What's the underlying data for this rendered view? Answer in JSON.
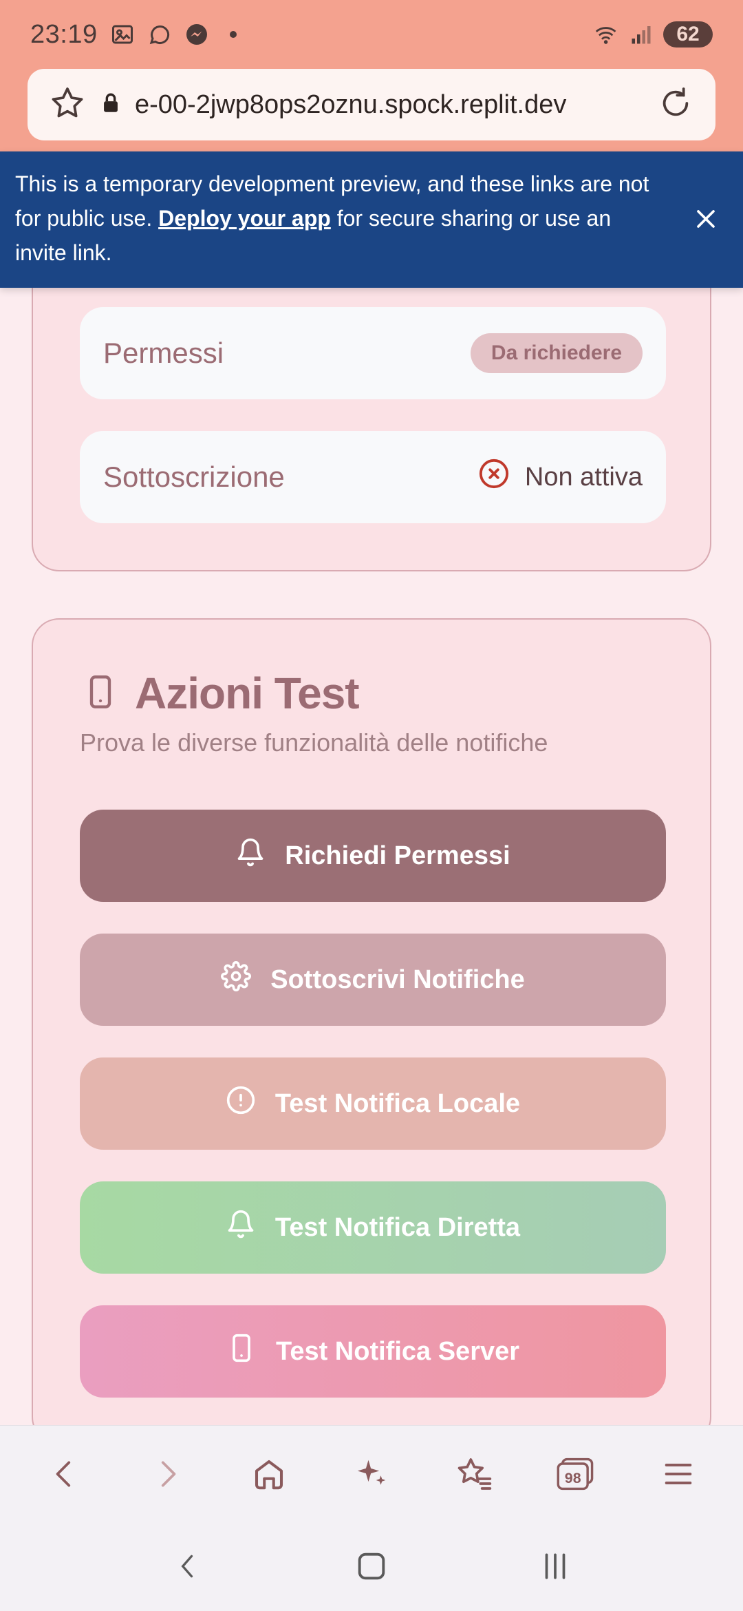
{
  "status_bar": {
    "time": "23:19",
    "battery": "62",
    "icons": [
      "gallery-icon",
      "whatsapp-icon",
      "messenger-icon",
      "notification-dot",
      "wifi-icon",
      "signal-icon"
    ]
  },
  "url_bar": {
    "url": "e-00-2jwp8ops2oznu.spock.replit.dev"
  },
  "banner": {
    "text_before": "This is a temporary development preview, and these links are not for public use. ",
    "link_label": "Deploy your app",
    "text_after": " for secure sharing or use an invite link."
  },
  "status_card": {
    "permissions_label": "Permessi",
    "permissions_badge": "Da richiedere",
    "subscription_label": "Sottoscrizione",
    "subscription_status": "Non attiva"
  },
  "test_card": {
    "title": "Azioni Test",
    "subtitle": "Prova le diverse funzionalità delle notifiche",
    "buttons": [
      {
        "label": "Richiedi Permessi",
        "icon": "bell-icon"
      },
      {
        "label": "Sottoscrivi Notifiche",
        "icon": "gear-icon"
      },
      {
        "label": "Test Notifica Locale",
        "icon": "alert-circle-icon"
      },
      {
        "label": "Test Notifica Diretta",
        "icon": "bell-icon"
      },
      {
        "label": "Test Notifica Server",
        "icon": "smartphone-icon"
      }
    ]
  },
  "browser_toolbar": {
    "tabs_count": "98"
  },
  "colors": {
    "status_bar_bg": "#f4a28f",
    "banner_bg": "#1b4585",
    "card_bg": "#fbe1e5",
    "primary_button": "#9b6f75",
    "text_rose": "#9b6b73"
  }
}
